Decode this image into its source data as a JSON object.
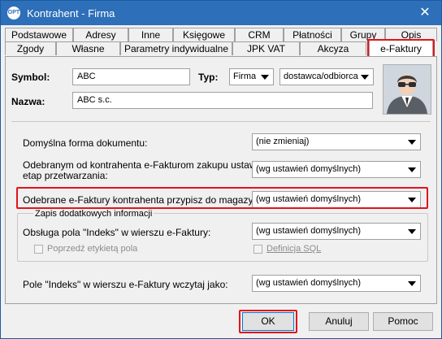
{
  "window": {
    "title": "Kontrahent - Firma",
    "app_icon_text": "OPT"
  },
  "tabs_row1": [
    "Podstawowe",
    "Adresy",
    "Inne",
    "Księgowe",
    "CRM",
    "Płatności",
    "Grupy",
    "Opis"
  ],
  "tabs_row2": [
    "Zgody",
    "Własne",
    "Parametry indywidualne",
    "JPK VAT",
    "Akcyza",
    "e-Faktury"
  ],
  "header": {
    "symbol_label": "Symbol:",
    "symbol_value": "ABC",
    "typ_label": "Typ:",
    "typ_value": "Firma",
    "role_value": "dostawca/odbiorca",
    "nazwa_label": "Nazwa:",
    "nazwa_value": "ABC s.c."
  },
  "form": {
    "row1_label": "Domyślna forma dokumentu:",
    "row1_value": "(nie zmieniaj)",
    "row2_label_line1": "Odebranym od kontrahenta e-Fakturom zakupu ustaw",
    "row2_label_line2": "etap przetwarzania:",
    "row2_value": "(wg ustawień domyślnych)",
    "row3_label": "Odebrane e-Faktury kontrahenta przypisz do magazynu:",
    "row3_value": "(wg ustawień domyślnych)",
    "group_title": "Zapis dodatkowych informacji",
    "row4_label": "Obsługa pola \"Indeks\" w wierszu e-Faktury:",
    "row4_value": "(wg ustawień domyślnych)",
    "check1_label": "Poprzedź etykietą pola",
    "check2_label": "Definicja SQL",
    "row5_label": "Pole \"Indeks\" w wierszu e-Faktury wczytaj jako:",
    "row5_value": "(wg ustawień domyślnych)"
  },
  "buttons": {
    "ok": "OK",
    "cancel": "Anuluj",
    "help": "Pomoc"
  },
  "colors": {
    "titlebar": "#2d6fb8",
    "highlight": "#e0141b"
  }
}
